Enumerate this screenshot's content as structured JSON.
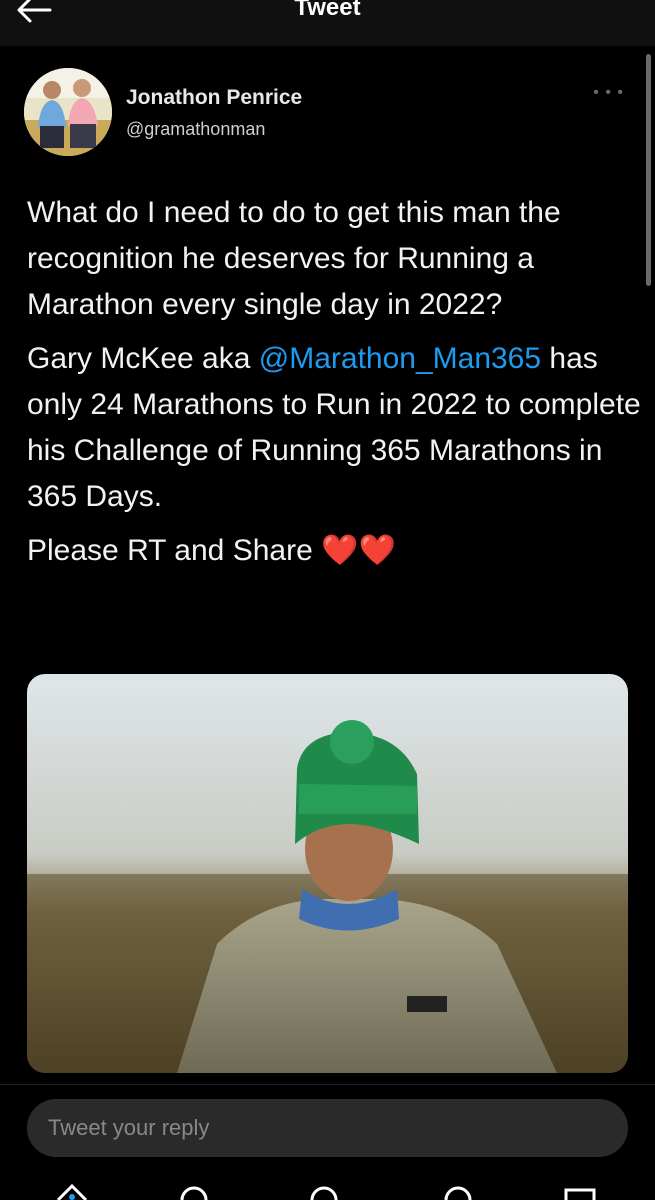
{
  "topbar": {
    "title": "Tweet",
    "back_icon": "arrow-left-icon"
  },
  "author": {
    "display_name": "Jonathon Penrice",
    "handle": "@gramathonman",
    "more_icon": "more-horizontal-icon"
  },
  "tweet": {
    "paragraph1": "What do I need to do to get this man the recognition he deserves for Running a Marathon every single day in 2022?",
    "paragraph2_before": "Gary McKee aka ",
    "mention": "@Marathon_Man365",
    "paragraph2_after": " has only 24 Marathons to Run in 2022 to complete his Challenge of Running 365 Marathons in 365 Days.",
    "paragraph3": "Please RT and Share ",
    "hearts": "❤️❤️"
  },
  "reply": {
    "placeholder": "Tweet your reply"
  },
  "bottom_nav": [
    "home-icon",
    "search-icon",
    "spaces-icon",
    "notifications-icon",
    "messages-icon"
  ],
  "colors": {
    "accent": "#1d9bf0",
    "background": "#000000",
    "topbar": "#101010",
    "reply_bar": "#2a2a2a"
  }
}
